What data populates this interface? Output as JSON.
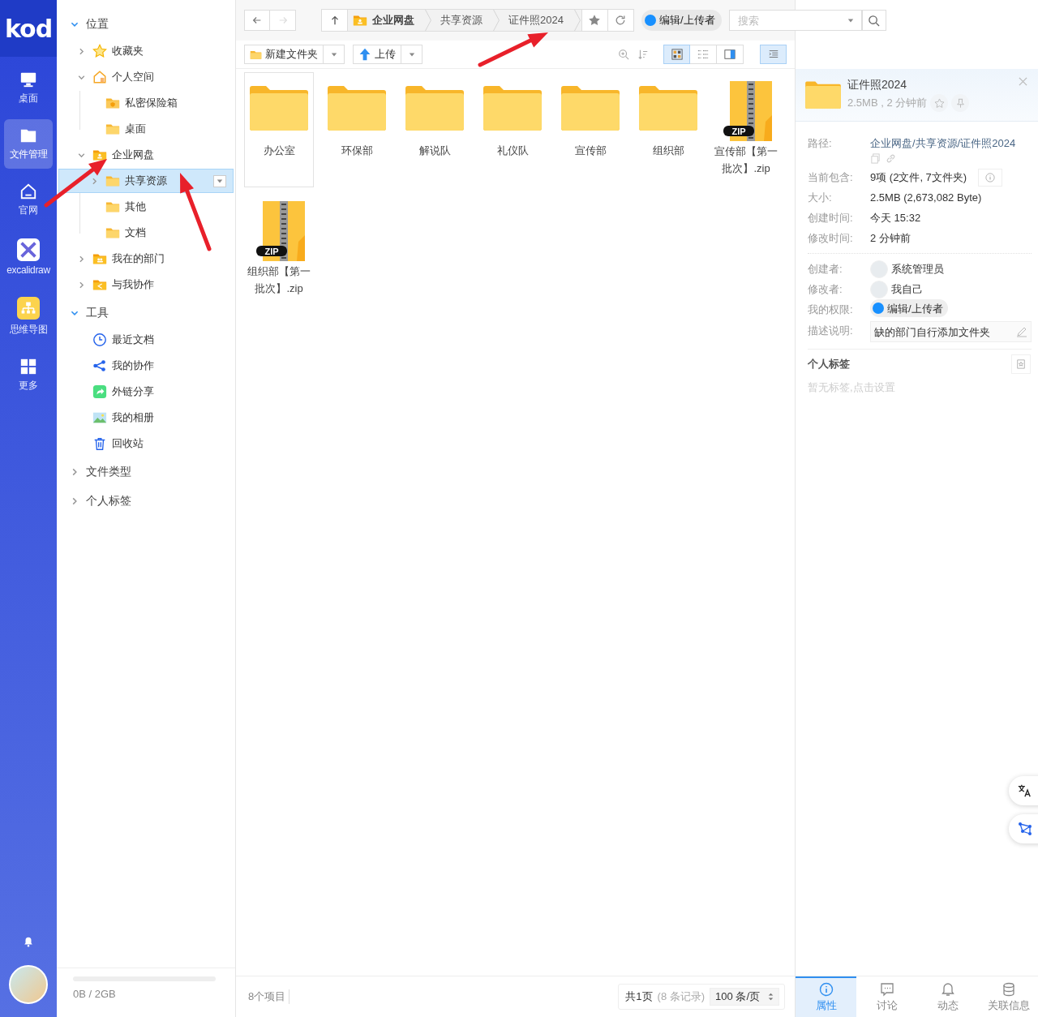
{
  "rail": {
    "logo": "kod",
    "items": [
      {
        "label": "桌面",
        "kind": "monitor",
        "selected": false
      },
      {
        "label": "文件管理",
        "kind": "folder",
        "selected": true
      },
      {
        "label": "官网",
        "kind": "home",
        "selected": false
      },
      {
        "label": "excalidraw",
        "kind": "excalidraw",
        "selected": false
      },
      {
        "label": "思维导图",
        "kind": "mindmap",
        "selected": false
      },
      {
        "label": "更多",
        "kind": "grid",
        "selected": false
      }
    ]
  },
  "tree": {
    "sections": [
      {
        "title": "位置",
        "expanded": true,
        "items": [
          {
            "label": "收藏夹",
            "kind": "star",
            "expanded": false,
            "selected": false
          },
          {
            "label": "个人空间",
            "kind": "home",
            "expanded": true,
            "selected": false,
            "children": [
              {
                "label": "私密保险箱",
                "kind": "safe",
                "selected": false
              },
              {
                "label": "桌面",
                "kind": "folder",
                "selected": false
              }
            ]
          },
          {
            "label": "企业网盘",
            "kind": "enterprise",
            "expanded": true,
            "selected": false,
            "children": [
              {
                "label": "共享资源",
                "kind": "folder",
                "expanded": false,
                "selected": true
              },
              {
                "label": "其他",
                "kind": "folder",
                "selected": false
              },
              {
                "label": "文档",
                "kind": "folder",
                "selected": false
              }
            ]
          },
          {
            "label": "我在的部门",
            "kind": "group",
            "expanded": false,
            "selected": false
          },
          {
            "label": "与我协作",
            "kind": "share",
            "expanded": false,
            "selected": false
          }
        ]
      },
      {
        "title": "工具",
        "expanded": true,
        "items": [
          {
            "label": "最近文档",
            "kind": "clock",
            "selected": false
          },
          {
            "label": "我的协作",
            "kind": "nodes",
            "selected": false
          },
          {
            "label": "外链分享",
            "kind": "linkshare",
            "selected": false
          },
          {
            "label": "我的相册",
            "kind": "photo",
            "selected": false
          },
          {
            "label": "回收站",
            "kind": "trash",
            "selected": false
          }
        ]
      },
      {
        "title": "文件类型",
        "expanded": false
      },
      {
        "title": "个人标签",
        "expanded": false
      }
    ]
  },
  "quota": {
    "text": "0B / 2GB",
    "level": 0
  },
  "address_bar": {
    "forward_disabled": true,
    "crumbs": [
      {
        "label": "企业网盘",
        "root": true
      },
      {
        "label": "共享资源",
        "root": false
      },
      {
        "label": "证件照2024",
        "root": false
      }
    ],
    "permission": "编辑/上传者",
    "search": {
      "placeholder": "搜索"
    }
  },
  "toolbar": {
    "new_folder": "新建文件夹",
    "upload": "上传",
    "views": [
      {
        "kind": "icons",
        "selected": true
      },
      {
        "kind": "list",
        "selected": false
      },
      {
        "kind": "split",
        "selected": false
      }
    ],
    "details_open": true
  },
  "files": [
    {
      "name": "办公室",
      "kind": "folder",
      "selected": true
    },
    {
      "name": "环保部",
      "kind": "folder",
      "selected": false
    },
    {
      "name": "解说队",
      "kind": "folder",
      "selected": false
    },
    {
      "name": "礼仪队",
      "kind": "folder",
      "selected": false
    },
    {
      "name": "宣传部",
      "kind": "folder",
      "selected": false
    },
    {
      "name": "组织部",
      "kind": "folder",
      "selected": false
    },
    {
      "name": "宣传部【第一批次】.zip",
      "kind": "zip",
      "badge": "ZIP",
      "selected": false
    },
    {
      "name": "组织部【第一批次】.zip",
      "kind": "zip",
      "badge": "ZIP",
      "selected": false
    }
  ],
  "footer": {
    "count": "8个项目",
    "pages": "共1页",
    "records": "(8 条记录)",
    "per_page": "100 条/页"
  },
  "details": {
    "title": "证件照2024",
    "meta": "2.5MB , 2 分钟前",
    "file_info": [
      {
        "label": "路径:",
        "value": "企业网盘/共享资源/证件照2024",
        "kind": "link"
      },
      {
        "label": "当前包含:",
        "value": "9项 (2文件, 7文件夹)",
        "kind": "count"
      },
      {
        "label": "大小:",
        "value": "2.5MB (2,673,082 Byte)",
        "kind": "text"
      },
      {
        "label": "创建时间:",
        "value": "今天 15:32",
        "kind": "text"
      },
      {
        "label": "修改时间:",
        "value": "2 分钟前",
        "kind": "text"
      }
    ],
    "owner_info": [
      {
        "label": "创建者:",
        "value": "系统管理员",
        "kind": "user"
      },
      {
        "label": "修改者:",
        "value": "我自己",
        "kind": "user"
      },
      {
        "label": "我的权限:",
        "value": "编辑/上传者",
        "kind": "badge"
      },
      {
        "label": "描述说明:",
        "value": "缺的部门自行添加文件夹",
        "kind": "description"
      }
    ],
    "tags_title": "个人标签",
    "tags_empty": "暂无标签,点击设置",
    "tabs": [
      {
        "label": "属性",
        "kind": "info",
        "selected": true
      },
      {
        "label": "讨论",
        "kind": "chat",
        "selected": false
      },
      {
        "label": "动态",
        "kind": "bell",
        "selected": false
      },
      {
        "label": "关联信息",
        "kind": "db",
        "selected": false
      }
    ]
  }
}
